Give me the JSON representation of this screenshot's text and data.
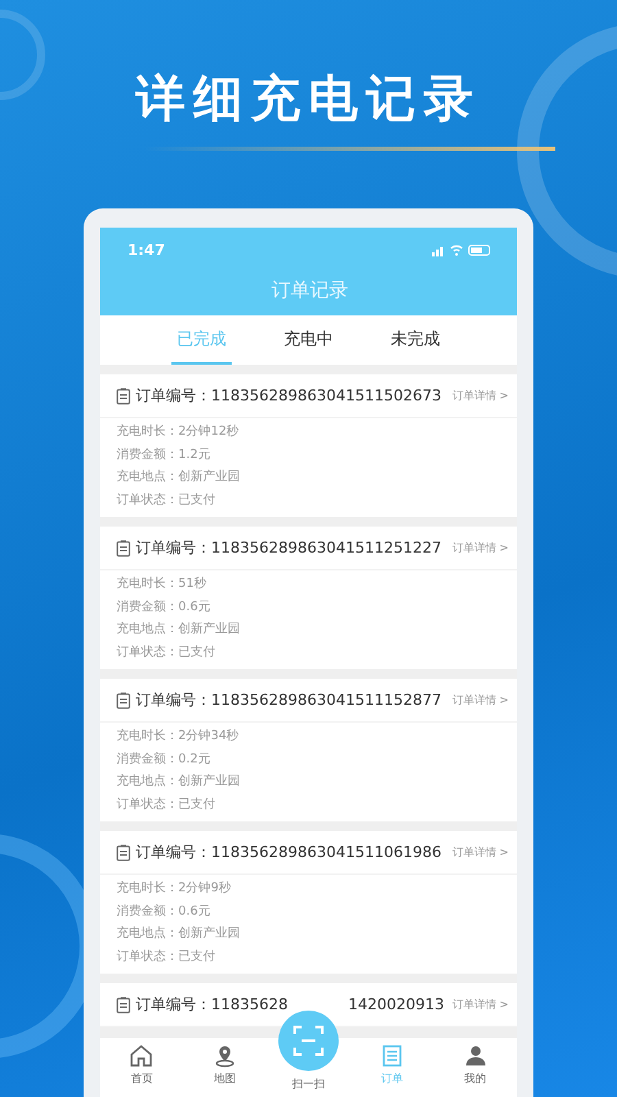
{
  "headline": "详细充电记录",
  "status_bar": {
    "time": "1:47"
  },
  "screen_title": "订单记录",
  "tabs": [
    {
      "label": "已完成",
      "selected": true
    },
    {
      "label": "充电中",
      "selected": false
    },
    {
      "label": "未完成",
      "selected": false
    }
  ],
  "orders": [
    {
      "order_label": "订单编号：",
      "order_number": "118356289863041511502673",
      "detail_link": "订单详情 >",
      "fields": [
        {
          "label": "充电时长：",
          "value": "2分钟12秒"
        },
        {
          "label": "消费金额：",
          "value": "1.2元"
        },
        {
          "label": "充电地点：",
          "value": "创新产业园"
        },
        {
          "label": "订单状态：",
          "value": "已支付"
        }
      ]
    },
    {
      "order_label": "订单编号：",
      "order_number": "118356289863041511251227",
      "detail_link": "订单详情 >",
      "fields": [
        {
          "label": "充电时长：",
          "value": "51秒"
        },
        {
          "label": "消费金额：",
          "value": "0.6元"
        },
        {
          "label": "充电地点：",
          "value": "创新产业园"
        },
        {
          "label": "订单状态：",
          "value": "已支付"
        }
      ]
    },
    {
      "order_label": "订单编号：",
      "order_number": "118356289863041511152877",
      "detail_link": "订单详情 >",
      "fields": [
        {
          "label": "充电时长：",
          "value": "2分钟34秒"
        },
        {
          "label": "消费金额：",
          "value": "0.2元"
        },
        {
          "label": "充电地点：",
          "value": "创新产业园"
        },
        {
          "label": "订单状态：",
          "value": "已支付"
        }
      ]
    },
    {
      "order_label": "订单编号：",
      "order_number": "118356289863041511061986",
      "detail_link": "订单详情 >",
      "fields": [
        {
          "label": "充电时长：",
          "value": "2分钟9秒"
        },
        {
          "label": "消费金额：",
          "value": "0.6元"
        },
        {
          "label": "充电地点：",
          "value": "创新产业园"
        },
        {
          "label": "订单状态：",
          "value": "已支付"
        }
      ]
    }
  ],
  "partial_order": {
    "order_label": "订单编号：",
    "number_start": "11835628",
    "number_end": "1420020913",
    "detail_link": "订单详情 >"
  },
  "nav": [
    {
      "kind": "home",
      "label": "首页",
      "selected": false
    },
    {
      "kind": "map",
      "label": "地图",
      "selected": false
    },
    {
      "kind": "scan",
      "label": "扫一扫",
      "selected": false
    },
    {
      "kind": "orders",
      "label": "订单",
      "selected": true
    },
    {
      "kind": "profile",
      "label": "我的",
      "selected": false
    }
  ]
}
